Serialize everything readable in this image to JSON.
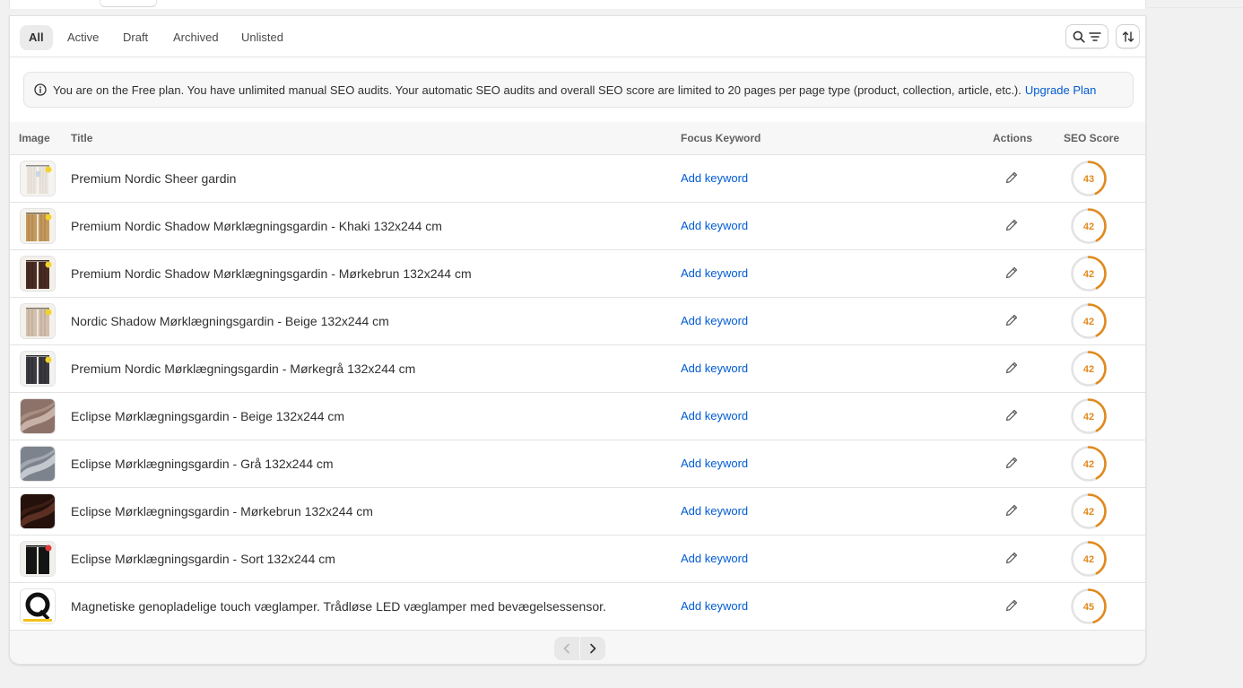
{
  "tabs": [
    "All",
    "Active",
    "Draft",
    "Archived",
    "Unlisted"
  ],
  "banner": {
    "text": "You are on the Free plan. You have unlimited manual SEO audits. Your automatic SEO audits and overall SEO score are limited to 20 pages per page type (product, collection, article, etc.).",
    "link": "Upgrade Plan"
  },
  "columns": {
    "image": "Image",
    "title": "Title",
    "keyword": "Focus Keyword",
    "actions": "Actions",
    "score": "SEO Score"
  },
  "rows": [
    {
      "title": "Premium Nordic Sheer gardin",
      "keyword": "Add keyword",
      "score": "43",
      "thumb": "sheer-curtain"
    },
    {
      "title": "Premium Nordic Shadow Mørklægningsgardin - Khaki 132x244 cm",
      "keyword": "Add keyword",
      "score": "42",
      "thumb": "khaki-curtain"
    },
    {
      "title": "Premium Nordic Shadow Mørklægningsgardin - Mørkebrun 132x244 cm",
      "keyword": "Add keyword",
      "score": "42",
      "thumb": "brown-curtain"
    },
    {
      "title": "Nordic Shadow Mørklægningsgardin - Beige 132x244 cm",
      "keyword": "Add keyword",
      "score": "42",
      "thumb": "beige-curtain"
    },
    {
      "title": "Premium Nordic Mørklægningsgardin - Mørkegrå 132x244 cm",
      "keyword": "Add keyword",
      "score": "42",
      "thumb": "darkgray-curtain"
    },
    {
      "title": "Eclipse Mørklægningsgardin - Beige 132x244 cm",
      "keyword": "Add keyword",
      "score": "42",
      "thumb": "beige-fabric"
    },
    {
      "title": "Eclipse Mørklægningsgardin - Grå 132x244 cm",
      "keyword": "Add keyword",
      "score": "42",
      "thumb": "gray-fabric"
    },
    {
      "title": "Eclipse Mørklægningsgardin - Mørkebrun 132x244 cm",
      "keyword": "Add keyword",
      "score": "42",
      "thumb": "brown-fabric"
    },
    {
      "title": "Eclipse Mørklægningsgardin - Sort 132x244 cm",
      "keyword": "Add keyword",
      "score": "42",
      "thumb": "black-curtain"
    },
    {
      "title": "Magnetiske genopladelige touch væglamper. Trådløse LED væglamper med bevægelsessensor.",
      "keyword": "Add keyword",
      "score": "45",
      "thumb": "wall-lamp"
    }
  ],
  "colors": {
    "link": "#005bd3",
    "score_ring": "#e08a1e",
    "score_track": "#e3e3e3"
  },
  "icons": [
    "info-icon",
    "search-icon",
    "filter-icon",
    "sort-icon",
    "edit-pencil-icon",
    "chevron-left-icon",
    "chevron-right-icon"
  ]
}
